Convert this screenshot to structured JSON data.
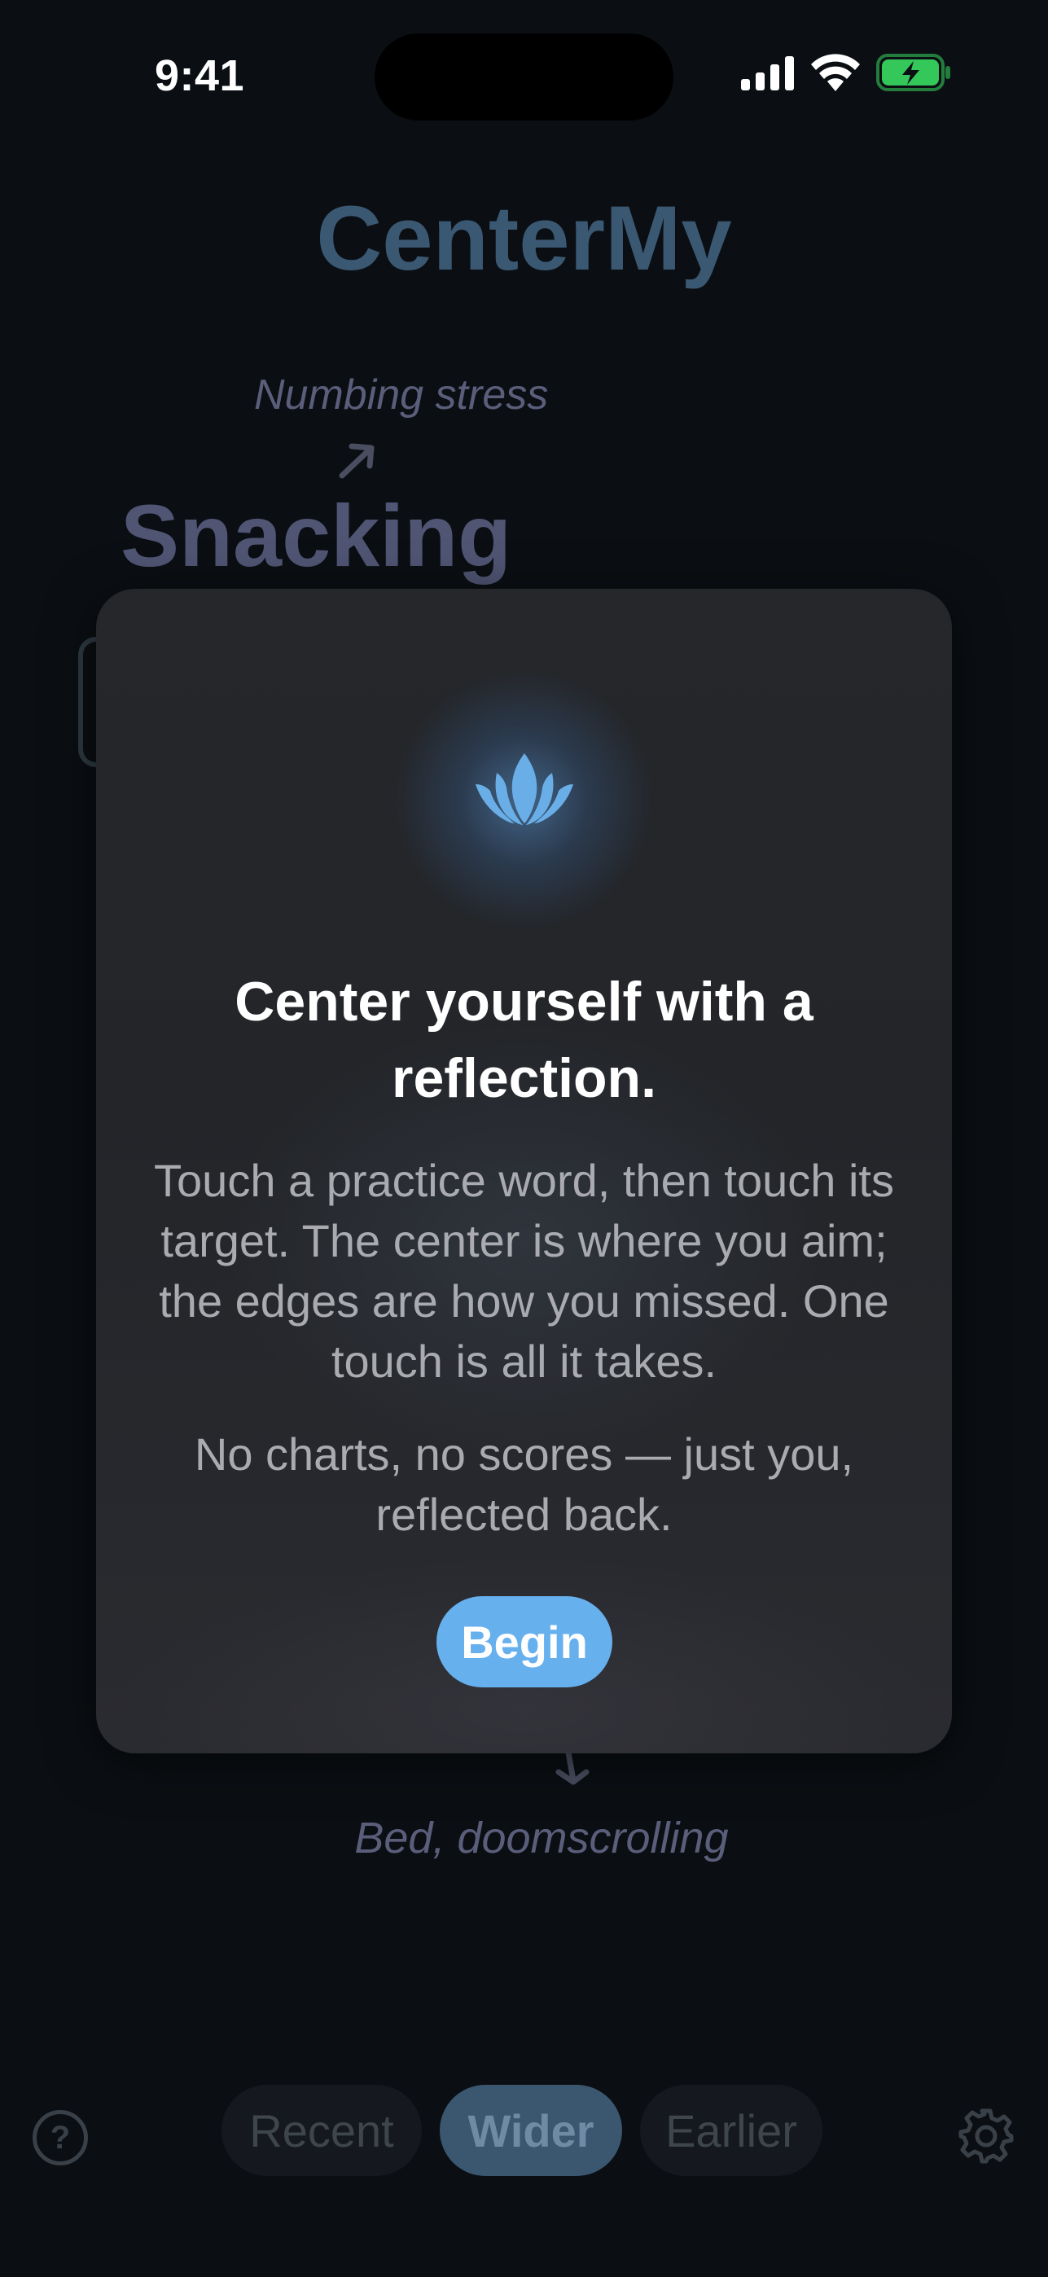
{
  "status_bar": {
    "time": "9:41",
    "battery_color": "#34c759"
  },
  "app": {
    "title": "CenterMy",
    "practice_word": "Snacking",
    "top_tag": "Numbing stress",
    "bottom_tag": "Bed, doomscrolling"
  },
  "modal": {
    "icon": "lotus-icon",
    "title": "Center yourself with a reflection.",
    "paragraph_1": "Touch a practice word, then touch its target. The center is where you aim; the edges are how you missed. One touch is all it takes.",
    "paragraph_2": "No charts, no scores — just you, reflected back.",
    "begin_label": "Begin",
    "accent_color": "#67b0ee"
  },
  "bottom_bar": {
    "help_label": "?",
    "segments": [
      "Recent",
      "Wider",
      "Earlier"
    ],
    "selected_segment": "Wider"
  }
}
